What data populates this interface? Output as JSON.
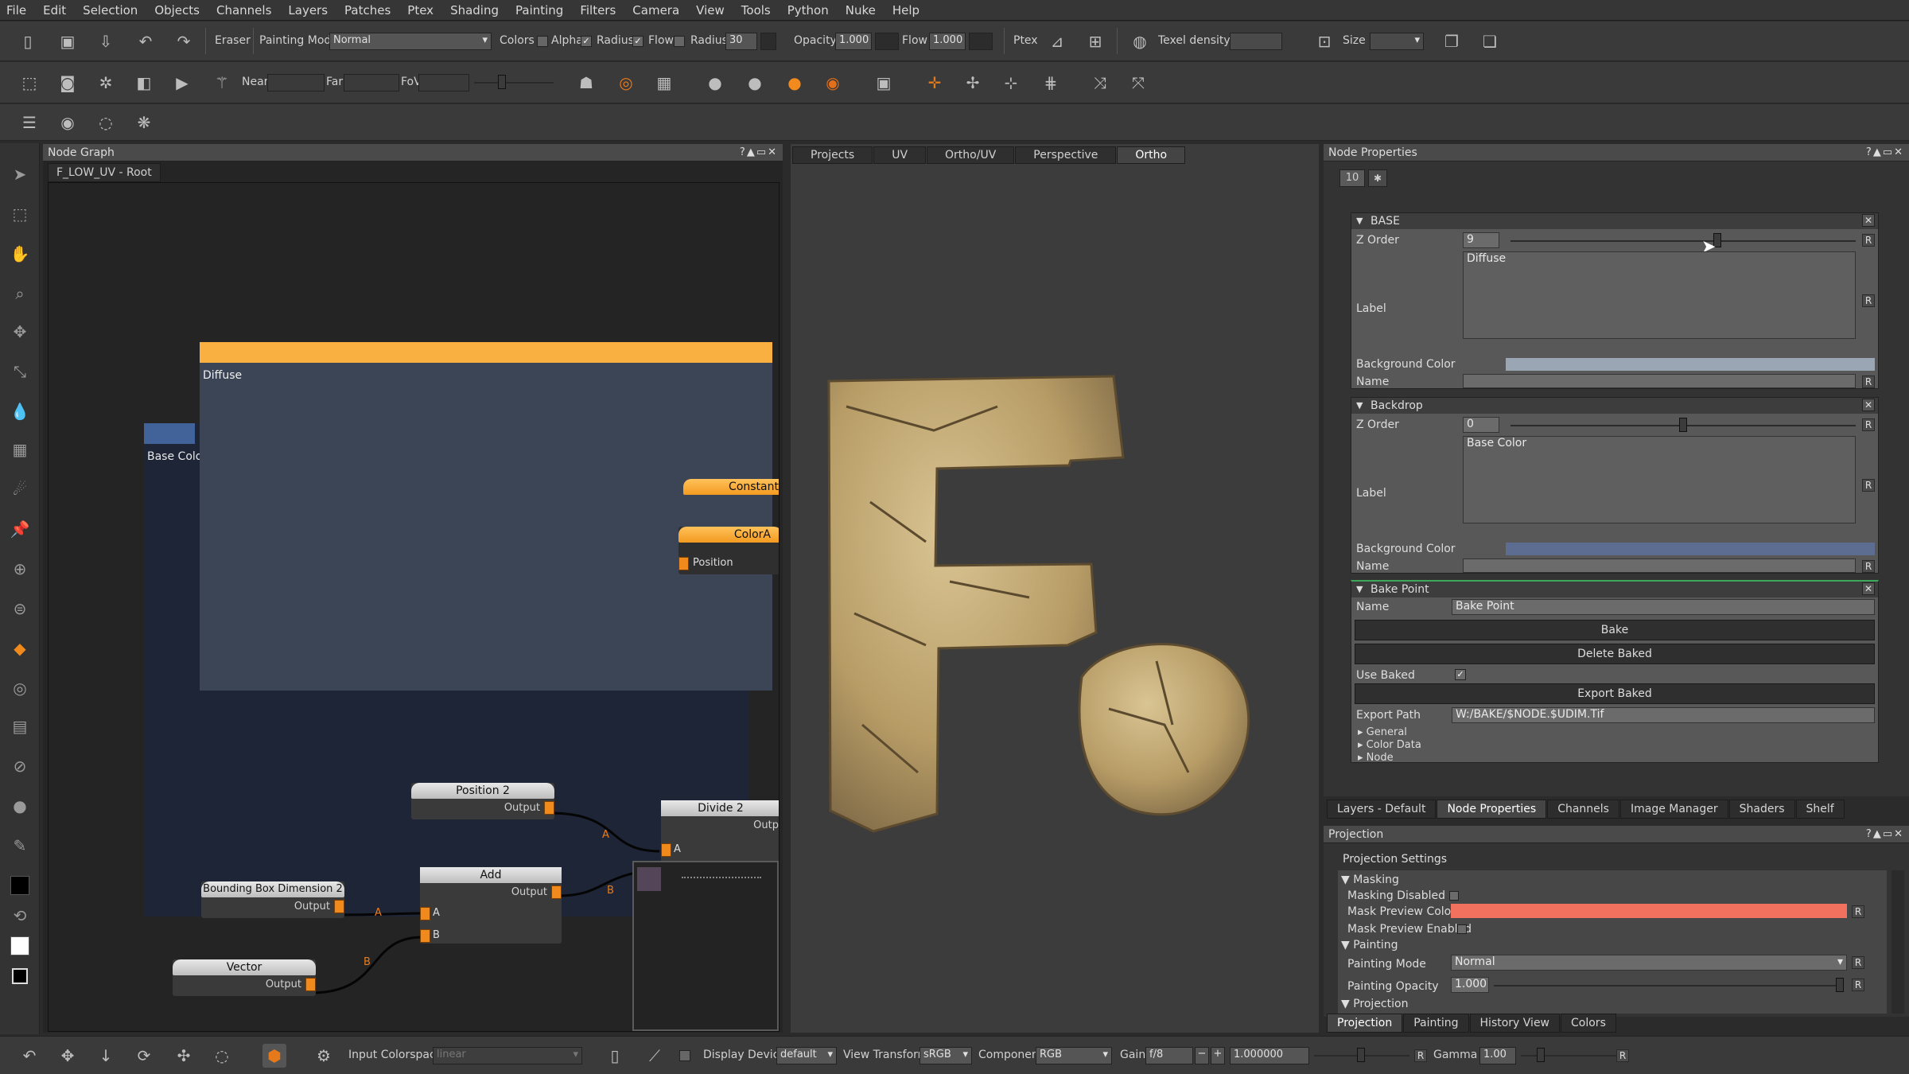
{
  "menu": [
    "File",
    "Edit",
    "Selection",
    "Objects",
    "Channels",
    "Layers",
    "Patches",
    "Ptex",
    "Shading",
    "Painting",
    "Filters",
    "Camera",
    "View",
    "Tools",
    "Python",
    "Nuke",
    "Help"
  ],
  "toolbar1": {
    "tool_name": "Eraser",
    "painting_mode_label": "Painting Mode",
    "painting_mode_value": "Normal",
    "colors_label": "Colors",
    "alpha_label": "Alpha",
    "radius_check_label": "Radius",
    "flow_check_label": "Flow",
    "radius_label": "Radius",
    "radius_value": "30",
    "opacity_label": "Opacity",
    "opacity_value": "1.000",
    "flow_label": "Flow",
    "flow_value": "1.000",
    "ptex_label": "Ptex",
    "texel_density_label": "Texel density :",
    "size_label": "Size :"
  },
  "toolbar2": {
    "near_label": "Near",
    "far_label": "Far",
    "fov_label": "FoV"
  },
  "node_graph": {
    "title": "Node Graph",
    "breadcrumb": "F_LOW_UV - Root",
    "backdrop_diffuse": "Diffuse",
    "backdrop_basecolor": "Base Color",
    "nodes": {
      "constant": "Constant",
      "colora": "ColorA",
      "position_port": "Position",
      "position2": "Position 2",
      "divide2": "Divide 2",
      "add": "Add",
      "bbox_dim2": "Bounding Box Dimension 2",
      "vector": "Vector",
      "output": "Output",
      "out_short": "Outp",
      "port_a": "A",
      "port_b": "B"
    }
  },
  "viewport": {
    "tabs": [
      "Projects",
      "UV",
      "Ortho/UV",
      "Perspective",
      "Ortho"
    ],
    "active_tab": "Ortho"
  },
  "node_properties": {
    "title": "Node Properties",
    "id_value": "10",
    "base": {
      "header": "BASE",
      "z_order_label": "Z Order",
      "z_order_value": "9",
      "z_order_level": 0.6,
      "label_label": "Label",
      "label_value": "Diffuse",
      "bg_color_label": "Background Color",
      "bg_color": "#9aa6b4",
      "name_label": "Name",
      "r": "R"
    },
    "backdrop": {
      "header": "Backdrop",
      "z_order_label": "Z Order",
      "z_order_value": "0",
      "z_order_level": 0.5,
      "label_label": "Label",
      "label_value": "Base Color",
      "bg_color_label": "Background Color",
      "bg_color": "#5d6d92",
      "name_label": "Name"
    },
    "bake_point": {
      "header": "Bake Point",
      "name_label": "Name",
      "name_value": "Bake Point",
      "bake_button": "Bake",
      "delete_button": "Delete Baked",
      "use_baked_label": "Use Baked",
      "export_button": "Export Baked",
      "export_path_label": "Export Path",
      "export_path_value": "W:/BAKE/$NODE.$UDIM.Tif",
      "sub_general": "General",
      "sub_color_data": "Color Data",
      "sub_node": "Node"
    }
  },
  "right_tabs": [
    "Layers - Default",
    "Node Properties",
    "Channels",
    "Image Manager",
    "Shaders",
    "Shelf"
  ],
  "projection": {
    "title": "Projection",
    "settings_label": "Projection Settings",
    "masking_header": "Masking",
    "masking_disabled": "Masking Disabled",
    "mask_preview_color": "Mask Preview Color",
    "mask_color": "#f2705e",
    "mask_preview_enabled": "Mask Preview Enabled",
    "painting_header": "Painting",
    "painting_mode_label": "Painting Mode",
    "painting_mode_value": "Normal",
    "painting_opacity_label": "Painting Opacity",
    "painting_opacity_value": "1.000",
    "projection_header": "Projection",
    "tabs": [
      "Projection",
      "Painting",
      "History View",
      "Colors"
    ]
  },
  "bottom": {
    "input_colorspace_label": "Input Colorspace",
    "input_colorspace_value": "linear",
    "display_device_label": "Display Device",
    "display_device_value": "default",
    "view_transform_label": "View Transform",
    "view_transform_value": "sRGB",
    "component_label": "Component",
    "component_value": "RGB",
    "gain_label": "Gain",
    "gain_value": "f/8",
    "gain_number": "1.000000",
    "gamma_label": "Gamma",
    "gamma_value": "1.00"
  }
}
